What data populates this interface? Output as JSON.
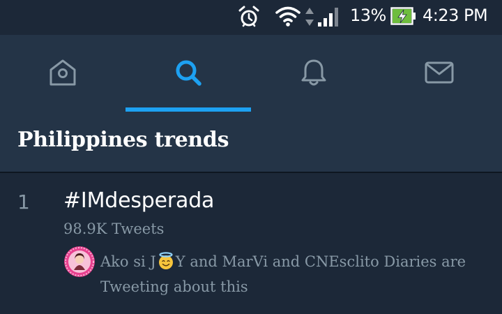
{
  "status_bar": {
    "battery_percent": "13%",
    "battery_level": 0.13,
    "time": "4:23 PM",
    "icons": [
      "alarm-icon",
      "wifi-icon",
      "data-updown-icon",
      "signal-icon",
      "battery-charging-icon"
    ]
  },
  "tabs": [
    {
      "id": "home",
      "icon": "home-icon",
      "active": false
    },
    {
      "id": "search",
      "icon": "search-icon",
      "active": true
    },
    {
      "id": "notifications",
      "icon": "bell-icon",
      "active": false
    },
    {
      "id": "messages",
      "icon": "mail-icon",
      "active": false
    }
  ],
  "section": {
    "title": "Philippines trends"
  },
  "trends": [
    {
      "rank": "1",
      "name": "#IMdesperada",
      "count": "98.9K Tweets",
      "context_before_emoji": "Ako si J",
      "context_emoji": "smiling-face-with-halo-emoji",
      "context_after_emoji": "Y and MarVi and CNEsclito Diaries are Tweeting about this"
    }
  ],
  "colors": {
    "background": "#1c2838",
    "header_background": "#243447",
    "accent": "#1da1f2",
    "secondary_text": "#8899a6",
    "primary_text": "#ffffff",
    "battery_charging": "#6ebd3e"
  }
}
